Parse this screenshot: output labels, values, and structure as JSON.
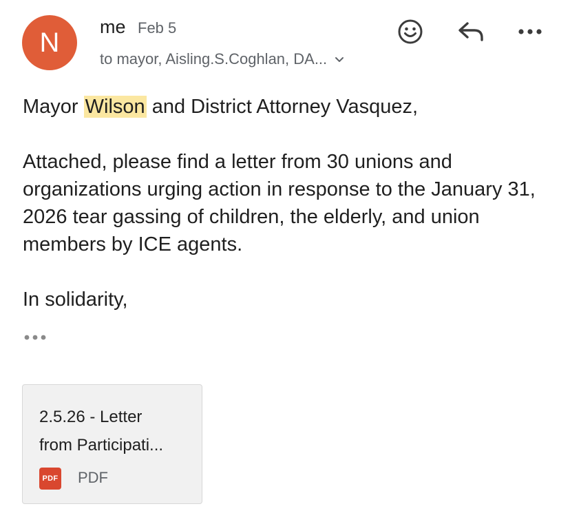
{
  "header": {
    "avatar_letter": "N",
    "avatar_color": "#e05d38",
    "sender": "me",
    "date": "Feb 5",
    "recipients": "to mayor, Aisling.S.Coghlan, DA...",
    "recipients_expand_icon": "chevron-down-icon",
    "actions": {
      "emoji_icon": "smiley-icon",
      "reply_icon": "reply-icon",
      "more_icon": "more-horizontal-icon"
    }
  },
  "message": {
    "greeting_before": "Mayor ",
    "greeting_highlight": "Wilson",
    "greeting_after": " and District Attorney Vasquez,",
    "paragraph": "Attached, please find a letter from 30 unions and organizations urging action in response to the January 31, 2026 tear gassing of children, the elderly, and union members by ICE agents.",
    "closing": "In solidarity,",
    "highlight_color": "#fbe7a1",
    "trimmed_icon": "ellipsis-icon"
  },
  "attachment": {
    "name_line1": "2.5.26 - Letter",
    "name_line2": "from Participati...",
    "type_badge": "PDF",
    "type_label": "PDF",
    "badge_color": "#d9472f"
  }
}
